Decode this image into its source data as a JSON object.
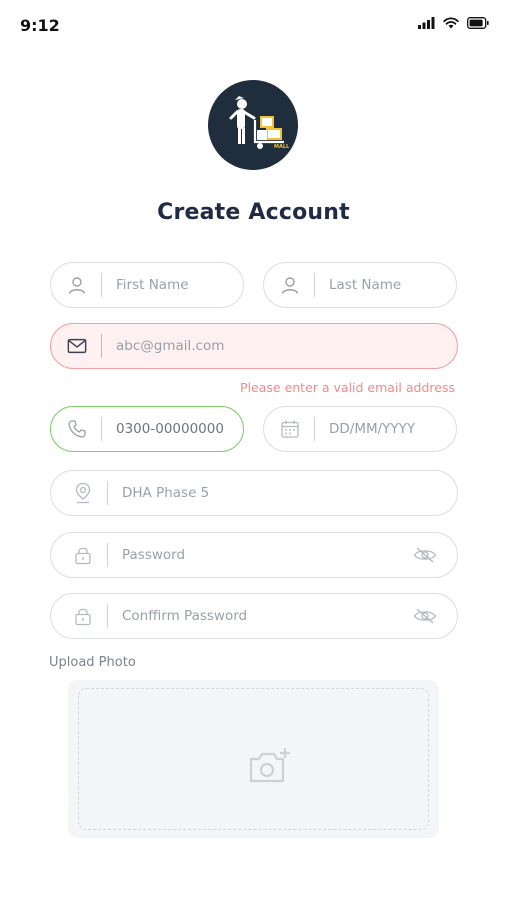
{
  "status_bar": {
    "time": "9:12",
    "icons": [
      "signal-icon",
      "wifi-icon",
      "battery-icon"
    ]
  },
  "logo": {
    "name": "app-logo",
    "background": "#1f2d3d"
  },
  "title": "Create Account",
  "form": {
    "first_name": {
      "placeholder": "First Name",
      "icon": "user-icon"
    },
    "last_name": {
      "placeholder": "Last Name",
      "icon": "user-icon"
    },
    "email": {
      "value": "abc@gmail.com",
      "icon": "mail-icon",
      "state": "error",
      "error": "Please enter a valid email address"
    },
    "phone": {
      "value": "0300-00000000",
      "icon": "phone-icon",
      "state": "valid"
    },
    "dob": {
      "placeholder": "DD/MM/YYYY",
      "icon": "calendar-icon"
    },
    "address": {
      "value": "DHA Phase 5",
      "icon": "location-pin-icon"
    },
    "password": {
      "placeholder": "Password",
      "icon": "lock-icon",
      "toggle_icon": "eye-off-icon"
    },
    "confirm_password": {
      "placeholder": "Conffirm Password",
      "icon": "lock-icon",
      "toggle_icon": "eye-off-icon"
    }
  },
  "upload": {
    "label": "Upload Photo",
    "icon": "add-camera-icon"
  },
  "colors": {
    "error_border": "#f4a0a0",
    "error_bg": "#fff0f1",
    "error_text": "#f08a8a",
    "valid_border": "#7dcf68",
    "title": "#1f2a44"
  }
}
